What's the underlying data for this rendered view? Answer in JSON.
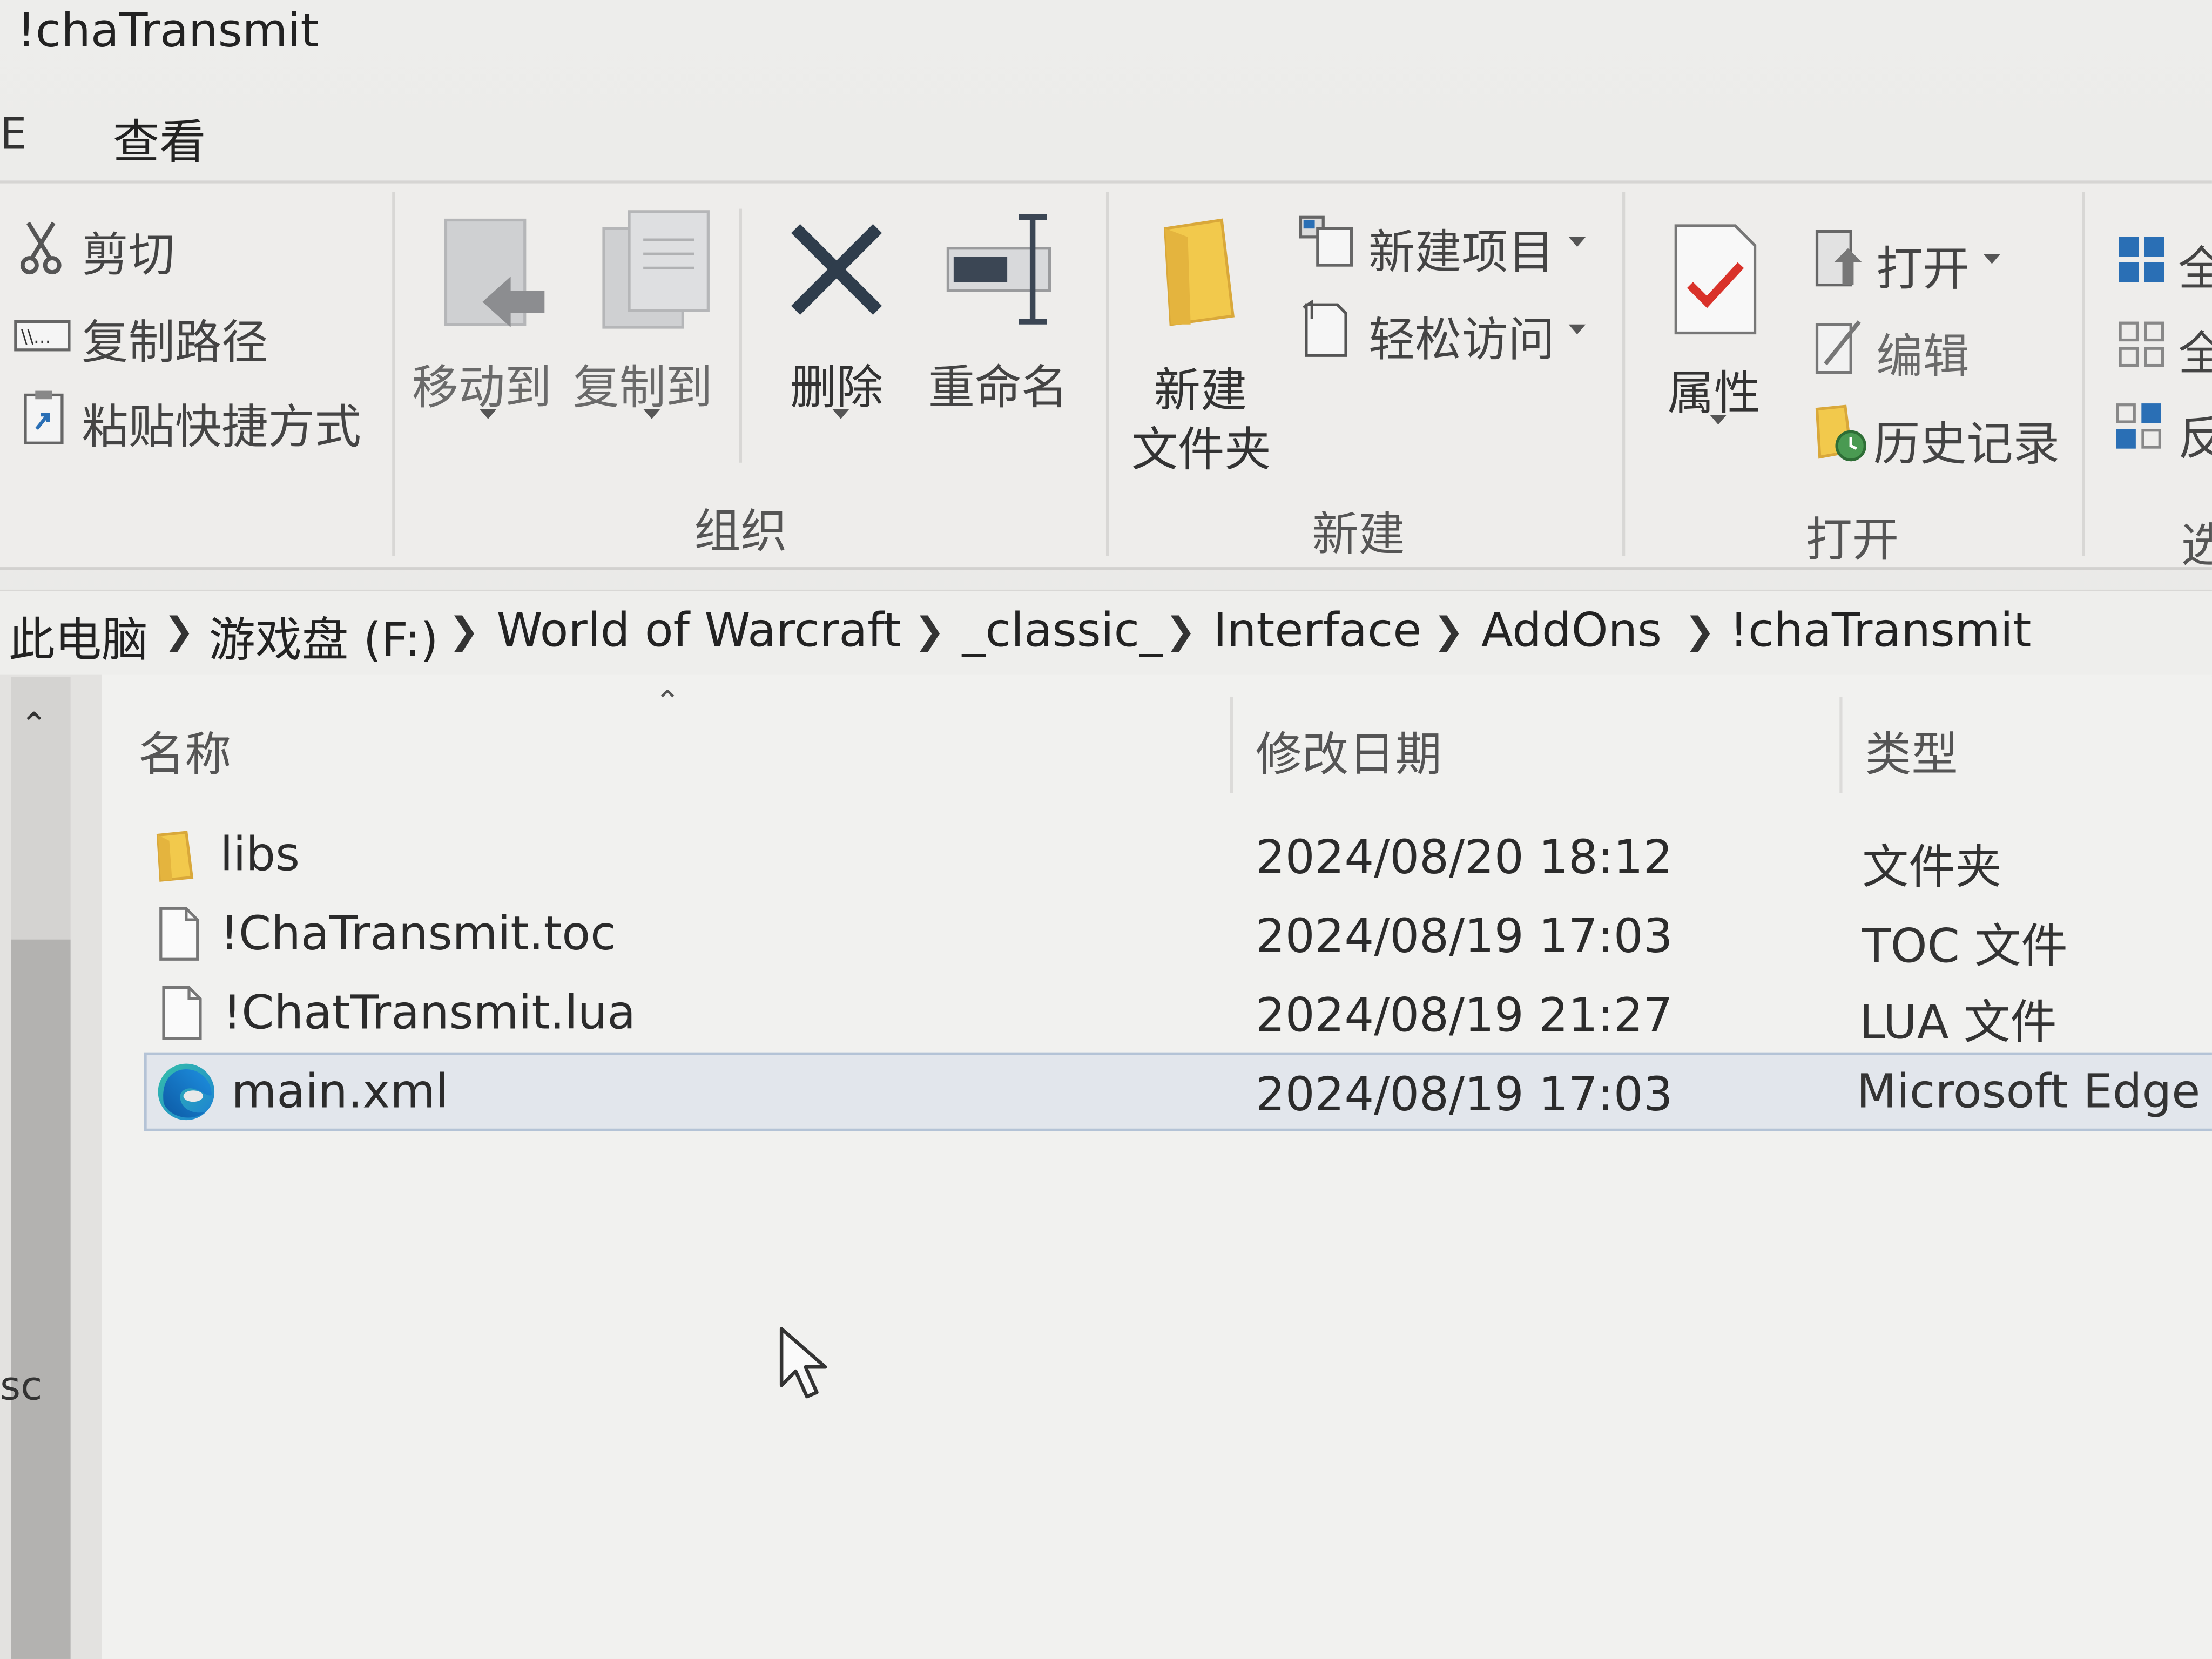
{
  "window": {
    "title": "!chaTransmit"
  },
  "menu_tabs": {
    "stub": "E",
    "view": "查看"
  },
  "ribbon": {
    "clipboard": {
      "cut": "剪切",
      "copy_path": "复制路径",
      "paste_shortcut": "粘贴快捷方式"
    },
    "organize": {
      "move_to": "移动到",
      "copy_to": "复制到",
      "delete": "删除",
      "rename": "重命名",
      "group_label": "组织"
    },
    "new": {
      "new_folder_line1": "新建",
      "new_folder_line2": "文件夹",
      "new_item": "新建项目",
      "easy_access": "轻松访问",
      "group_label": "新建"
    },
    "open": {
      "properties": "属性",
      "open": "打开",
      "edit": "编辑",
      "history": "历史记录",
      "group_label": "打开"
    },
    "select": {
      "select_all": "全",
      "select_none": "全",
      "invert": "反",
      "group_label": "选"
    }
  },
  "address_bar": {
    "crumbs": [
      "此电脑",
      "游戏盘 (F:)",
      "World of Warcraft",
      "_classic_",
      "Interface",
      "AddOns",
      "!chaTransmit"
    ]
  },
  "nav_pane": {
    "cut_label": "sc"
  },
  "file_list": {
    "columns": {
      "name": "名称",
      "modified": "修改日期",
      "type": "类型"
    },
    "rows": [
      {
        "name": "libs",
        "modified": "2024/08/20 18:12",
        "type": "文件夹",
        "icon": "folder-icon"
      },
      {
        "name": "!ChaTransmit.toc",
        "modified": "2024/08/19 17:03",
        "type": "TOC 文件",
        "icon": "file-icon"
      },
      {
        "name": "!ChatTransmit.lua",
        "modified": "2024/08/19 21:27",
        "type": "LUA 文件",
        "icon": "file-icon"
      },
      {
        "name": "main.xml",
        "modified": "2024/08/19 17:03",
        "type": "Microsoft Edge H",
        "icon": "edge-icon",
        "selected": true
      }
    ]
  }
}
